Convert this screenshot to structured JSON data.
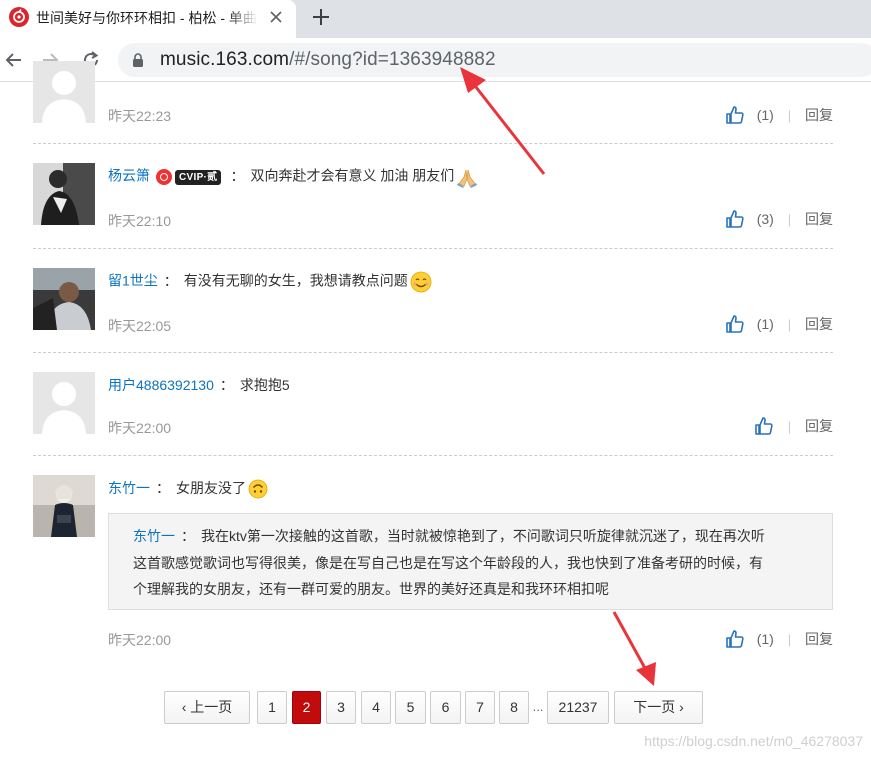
{
  "browser": {
    "tab_title": "世间美好与你环环相扣 - 柏松 - 单曲 - 网易云音乐",
    "url_host": "music.163.com",
    "url_path": "/#/song?id=1363948882"
  },
  "comments": [
    {
      "user": "",
      "text": "",
      "time": "昨天22:23",
      "likes": "(1)",
      "reply": "回复",
      "avatar": "default"
    },
    {
      "user": "杨云箫",
      "vip": "CVIP·贰",
      "text": "双向奔赴才会有意义 加油 朋友们",
      "emoji": "pray-emoji",
      "time": "昨天22:10",
      "likes": "(3)",
      "reply": "回复",
      "avatar": "photo-man"
    },
    {
      "user": "留1世尘",
      "text": "有没有无聊的女生，我想请教点问题",
      "emoji": "smile-emoji",
      "time": "昨天22:05",
      "likes": "(1)",
      "reply": "回复",
      "avatar": "photo-boy"
    },
    {
      "user": "用户4886392130",
      "text": "求抱抱5",
      "time": "昨天22:00",
      "likes": "",
      "reply": "回复",
      "avatar": "default"
    },
    {
      "user": "东竹一",
      "text": "女朋友没了",
      "emoji": "upside-down-emoji",
      "time": "昨天22:00",
      "likes": "(1)",
      "reply": "回复",
      "avatar": "photo-woman",
      "quote": {
        "user": "东竹一",
        "line1": "我在ktv第一次接触的这首歌，当时就被惊艳到了，不问歌词只听旋律就沉迷了，现在再次听",
        "line2": "这首歌感觉歌词也写得很美，像是在写自己也是在写这个年龄段的人，我也快到了准备考研的时候，有",
        "line3": "个理解我的女朋友，还有一群可爱的朋友。世界的美好还真是和我环环相扣呢"
      }
    }
  ],
  "comment_colon": "：",
  "pagination": {
    "prev": "上一页",
    "pages": [
      "1",
      "2",
      "3",
      "4",
      "5",
      "6",
      "7",
      "8"
    ],
    "current": "2",
    "ellipsis": "...",
    "last": "21237",
    "next": "下一页"
  },
  "watermark": "https://blog.csdn.net/m0_46278037",
  "colors": {
    "link_blue": "#0c73c2",
    "active_page": "#c20c0c",
    "annotation_arrow": "#e8343a"
  }
}
